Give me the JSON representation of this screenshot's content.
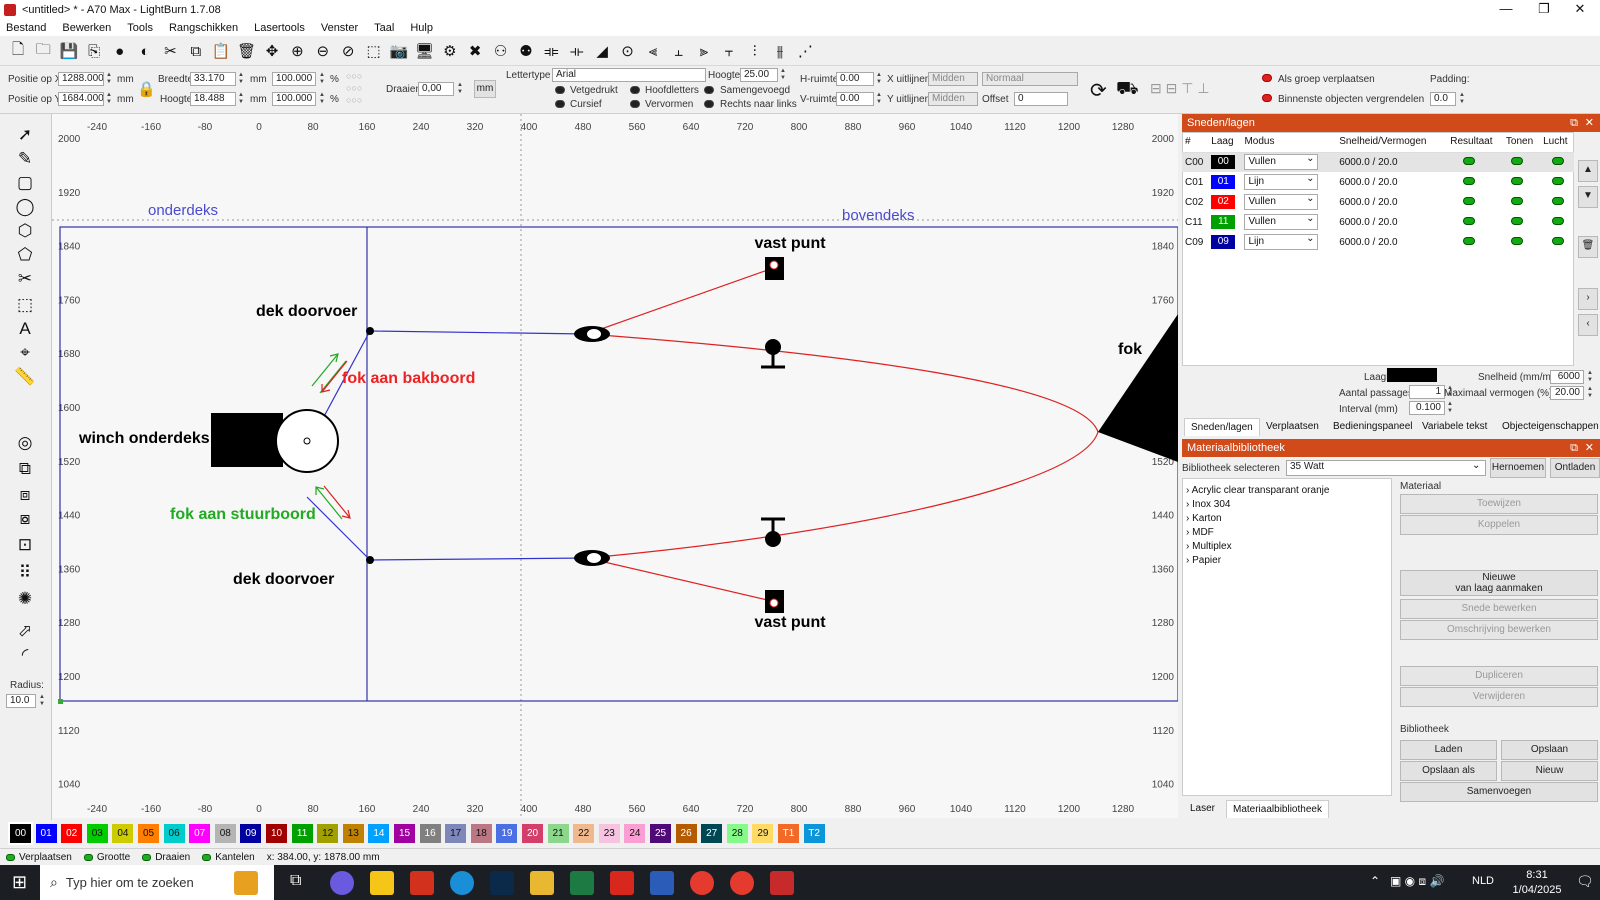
{
  "window": {
    "title": "<untitled> * - A70 Max - LightBurn 1.7.08",
    "min": "—",
    "max": "❐",
    "close": "✕"
  },
  "menu": [
    "Bestand",
    "Bewerken",
    "Tools",
    "Rangschikken",
    "Lasertools",
    "Venster",
    "Taal",
    "Hulp"
  ],
  "icons": {
    "toolbar": [
      "new-file-icon",
      "open-folder-icon",
      "save-icon",
      "export-icon",
      "import-icon",
      "save-gcode-icon",
      "cut-icon",
      "copy-icon",
      "paste-icon",
      "delete-icon",
      "move-icon",
      "zoom-in-icon",
      "zoom-out-icon",
      "zoom-fit-icon",
      "frame-select-icon",
      "camera-icon",
      "monitor-icon",
      "settings-icon",
      "tools-icon",
      "group-icon",
      "ungroup-icon",
      "mirror-h-icon",
      "mirror-v-icon",
      "rotate-icon",
      "align-center-icon",
      "align-left-icon",
      "align-top-icon",
      "align-right-icon",
      "align-bottom-icon",
      "distribute-h-icon",
      "distribute-v-icon",
      "dock-icon"
    ],
    "left": [
      "select-icon",
      "pen-icon",
      "rectangle-icon",
      "ellipse-icon",
      "polygon-icon",
      "bezier-icon",
      "node-edit-icon",
      "frame-icon",
      "text-icon",
      "position-icon",
      "measure-icon",
      "offset-icon",
      "weld-icon",
      "union-icon",
      "subtract-icon",
      "intersect-icon",
      "grid-array-icon",
      "circular-array-icon",
      "tab-icon",
      "corner-icon"
    ]
  },
  "props": {
    "pos_x_label": "Positie op X",
    "pos_x": "1288.000",
    "pos_y_label": "Positie op Y",
    "pos_y": "1684.000",
    "unit": "mm",
    "width_label": "Breedte",
    "width": "33.170",
    "height_label": "Hoogte",
    "height": "18.488",
    "scale_w": "100.000",
    "scale_h": "100.000",
    "pct": "%",
    "rotate_label": "Draaien",
    "rotate": "0,00",
    "mm_btn": "mm",
    "font_label": "Lettertype",
    "font": "Arial",
    "font_h_label": "Hoogte",
    "font_h": "25.00",
    "hspace_label": "H-ruimte",
    "hspace": "0.00",
    "vspace_label": "V-ruimte",
    "vspace": "0.00",
    "xalign_label": "X uitlijnen",
    "xalign": "Midden",
    "yalign_label": "Y uitlijnen",
    "yalign": "Midden",
    "style": "Normaal",
    "offset_label": "Offset",
    "offset": "0",
    "bold": "Vetgedrukt",
    "italic": "Cursief",
    "caps": "Hoofdletters",
    "distort": "Vervormen",
    "welded": "Samengevoegd",
    "rtl": "Rechts naar links",
    "group_move": "Als groep verplaatsen",
    "lock_inner": "Binnenste objecten vergrendelen",
    "padding_label": "Padding:",
    "padding": "0.0"
  },
  "ruler": {
    "x": [
      "-240",
      "-160",
      "-80",
      "0",
      "80",
      "160",
      "240",
      "320",
      "400",
      "480",
      "560",
      "640",
      "720",
      "800",
      "880",
      "960",
      "1040",
      "1120",
      "1200",
      "1280"
    ],
    "y": [
      "2000",
      "1920",
      "1840",
      "1760",
      "1680",
      "1600",
      "1520",
      "1440",
      "1360",
      "1280",
      "1200",
      "1120",
      "1040"
    ]
  },
  "drawing": {
    "onderdeks": "onderdeks",
    "bovendeks": "bovendeks",
    "vast_punt_top": "vast punt",
    "vast_punt_bottom": "vast punt",
    "dek_doorvoer_top": "dek doorvoer",
    "dek_doorvoer_bottom": "dek doorvoer",
    "fok_bakboord": "fok aan bakboord",
    "fok_stuurboord": "fok aan stuurboord",
    "winch": "winch onderdeks",
    "fok": "fok"
  },
  "palette": [
    {
      "l": "00",
      "c": "#000000",
      "t": "#fff"
    },
    {
      "l": "01",
      "c": "#0000ff",
      "t": "#fff"
    },
    {
      "l": "02",
      "c": "#ff0000",
      "t": "#fff"
    },
    {
      "l": "03",
      "c": "#00cc00",
      "t": "#111"
    },
    {
      "l": "04",
      "c": "#cccc00",
      "t": "#111"
    },
    {
      "l": "05",
      "c": "#ff8000",
      "t": "#111"
    },
    {
      "l": "06",
      "c": "#00cccc",
      "t": "#111"
    },
    {
      "l": "07",
      "c": "#ff00ff",
      "t": "#fff"
    },
    {
      "l": "08",
      "c": "#b4b4b4",
      "t": "#111"
    },
    {
      "l": "09",
      "c": "#0000a0",
      "t": "#fff"
    },
    {
      "l": "10",
      "c": "#a00000",
      "t": "#fff"
    },
    {
      "l": "11",
      "c": "#00a000",
      "t": "#fff"
    },
    {
      "l": "12",
      "c": "#a0a000",
      "t": "#111"
    },
    {
      "l": "13",
      "c": "#c08000",
      "t": "#111"
    },
    {
      "l": "14",
      "c": "#00a0ff",
      "t": "#fff"
    },
    {
      "l": "15",
      "c": "#a000a0",
      "t": "#fff"
    },
    {
      "l": "16",
      "c": "#808080",
      "t": "#fff"
    },
    {
      "l": "17",
      "c": "#7d87b9",
      "t": "#111"
    },
    {
      "l": "18",
      "c": "#bb7784",
      "t": "#111"
    },
    {
      "l": "19",
      "c": "#4a6fe3",
      "t": "#fff"
    },
    {
      "l": "20",
      "c": "#d33f6a",
      "t": "#fff"
    },
    {
      "l": "21",
      "c": "#8cd78c",
      "t": "#111"
    },
    {
      "l": "22",
      "c": "#f0b98d",
      "t": "#111"
    },
    {
      "l": "23",
      "c": "#f6c4e1",
      "t": "#111"
    },
    {
      "l": "24",
      "c": "#fa9ed4",
      "t": "#111"
    },
    {
      "l": "25",
      "c": "#500a78",
      "t": "#fff"
    },
    {
      "l": "26",
      "c": "#b45a00",
      "t": "#fff"
    },
    {
      "l": "27",
      "c": "#004754",
      "t": "#fff"
    },
    {
      "l": "28",
      "c": "#86fa88",
      "t": "#111"
    },
    {
      "l": "29",
      "c": "#ffdb66",
      "t": "#111"
    },
    {
      "l": "T1",
      "c": "#f36926",
      "t": "#fff"
    },
    {
      "l": "T2",
      "c": "#0c96d9",
      "t": "#fff"
    }
  ],
  "status": {
    "move": "Verplaatsen",
    "size": "Grootte",
    "rotate": "Draaien",
    "tilt": "Kantelen",
    "coords": "x: 384.00, y: 1878.00 mm"
  },
  "cuts": {
    "title": "Sneden/lagen",
    "headers": [
      "#",
      "Laag",
      "Modus",
      "Snelheid/Vermogen",
      "Resultaat",
      "Tonen",
      "Lucht"
    ],
    "rows": [
      {
        "id": "C00",
        "layer": "00",
        "color": "#000000",
        "mode": "Vullen",
        "sp": "6000.0 / 20.0"
      },
      {
        "id": "C01",
        "layer": "01",
        "color": "#0000ff",
        "mode": "Lijn",
        "sp": "6000.0 / 20.0"
      },
      {
        "id": "C02",
        "layer": "02",
        "color": "#ff0000",
        "mode": "Vullen",
        "sp": "6000.0 / 20.0"
      },
      {
        "id": "C11",
        "layer": "11",
        "color": "#00a000",
        "mode": "Vullen",
        "sp": "6000.0 / 20.0"
      },
      {
        "id": "C09",
        "layer": "09",
        "color": "#0000a0",
        "mode": "Lijn",
        "sp": "6000.0 / 20.0"
      }
    ],
    "layer_color_label": "Laagkleur",
    "passes_label": "Aantal passages",
    "passes": "1",
    "interval_label": "Interval (mm)",
    "interval": "0.100",
    "speed_label": "Snelheid (mm/m)",
    "speed": "6000",
    "power_label": "Maximaal vermogen (%)",
    "power": "20.00",
    "tabs": [
      "Sneden/lagen",
      "Verplaatsen",
      "Bedieningspaneel",
      "Variabele tekst",
      "Objecteigenschappen"
    ]
  },
  "material": {
    "title": "Materiaalbibliotheek",
    "select_label": "Bibliotheek selecteren",
    "library": "35 Watt",
    "rename": "Hernoemen",
    "unload": "Ontladen",
    "items": [
      "Acrylic clear transparant oranje",
      "Inox 304",
      "Karton",
      "MDF",
      "Multiplex",
      "Papier"
    ],
    "material_label": "Materiaal",
    "assign": "Toewijzen",
    "link": "Koppelen",
    "new_from_layer_1": "Nieuwe",
    "new_from_layer_2": "van laag aanmaken",
    "edit_cut": "Snede bewerken",
    "edit_desc": "Omschrijving bewerken",
    "duplicate": "Dupliceren",
    "remove": "Verwijderen",
    "library_label": "Bibliotheek",
    "load": "Laden",
    "save": "Opslaan",
    "save_as": "Opslaan als",
    "new": "Nieuw",
    "merge": "Samenvoegen",
    "tabs": [
      "Laser",
      "Materiaalbibliotheek"
    ]
  },
  "taskbar": {
    "search": "Typ hier om te zoeken",
    "lang": "NLD",
    "time": "8:31",
    "date": "1/04/2025"
  },
  "left": {
    "radius_label": "Radius:",
    "radius": "10.0"
  }
}
